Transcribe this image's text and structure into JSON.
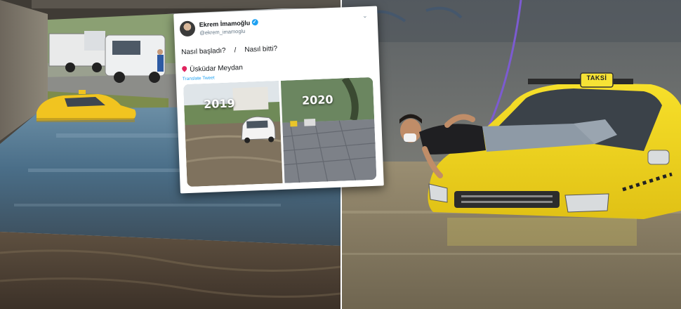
{
  "tweet": {
    "author_name": "Ekrem İmamoğlu",
    "handle": "@ekrem_imamoglu",
    "line1_part1": "Nasıl başladı?",
    "separator": "/",
    "line1_part2": "Nasıl bitti?",
    "location": "Üsküdar Meydan",
    "translate_link": "Translate Tweet",
    "media": {
      "left_year": "2019",
      "right_year": "2020"
    }
  },
  "right_photo": {
    "taxi_sign": "TAKSİ"
  },
  "colors": {
    "verified_badge": "#1da1f2",
    "location_pin": "#e0245e",
    "taxi_yellow": "#f2d21a",
    "floodwater": "#8a7f66"
  },
  "icons": [
    "verified-icon",
    "chevron-down-icon",
    "location-pin-icon"
  ]
}
